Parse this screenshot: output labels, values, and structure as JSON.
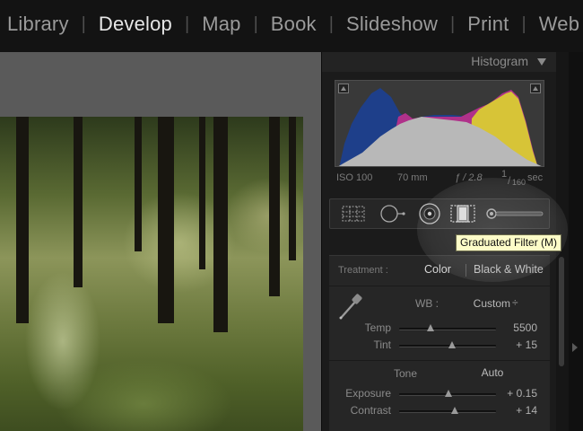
{
  "modules": [
    {
      "label": "Library",
      "active": false
    },
    {
      "label": "Develop",
      "active": true
    },
    {
      "label": "Map",
      "active": false
    },
    {
      "label": "Book",
      "active": false
    },
    {
      "label": "Slideshow",
      "active": false
    },
    {
      "label": "Print",
      "active": false
    },
    {
      "label": "Web",
      "active": false
    }
  ],
  "histogram": {
    "title": "Histogram",
    "iso": "ISO 100",
    "focal": "70 mm",
    "aperture": "ƒ / 2.8",
    "shutter_num": "1",
    "shutter_den": "160",
    "shutter_unit": "sec"
  },
  "tools": [
    {
      "name": "crop-overlay-tool-icon",
      "active": false
    },
    {
      "name": "spot-removal-tool-icon",
      "active": false
    },
    {
      "name": "red-eye-tool-icon",
      "active": false
    },
    {
      "name": "graduated-filter-tool-icon",
      "active": true
    },
    {
      "name": "adjustment-brush-tool-icon",
      "active": false
    }
  ],
  "tooltip": "Graduated Filter (M)",
  "basic": {
    "treatment_label": "Treatment :",
    "treatment_color": "Color",
    "treatment_bw": "Black & White",
    "wb_label": "WB :",
    "wb_value": "Custom",
    "wb_arrows": "÷",
    "temp_label": "Temp",
    "temp_value": "5500",
    "temp_position": 0.32,
    "tint_label": "Tint",
    "tint_value": "+ 15",
    "tint_position": 0.55,
    "tone_label": "Tone",
    "auto_label": "Auto",
    "exposure_label": "Exposure",
    "exposure_value": "+ 0.15",
    "exposure_position": 0.51,
    "contrast_label": "Contrast",
    "contrast_value": "+ 14",
    "contrast_position": 0.57
  },
  "colors": {
    "active_module": "#e6e6e6",
    "inactive_module": "#9a9a9a",
    "tooltip_bg": "#fdfcc8",
    "histogram_blue": "#1e3f8a",
    "histogram_yellow": "#d7c437",
    "histogram_magenta": "#b0318a"
  }
}
